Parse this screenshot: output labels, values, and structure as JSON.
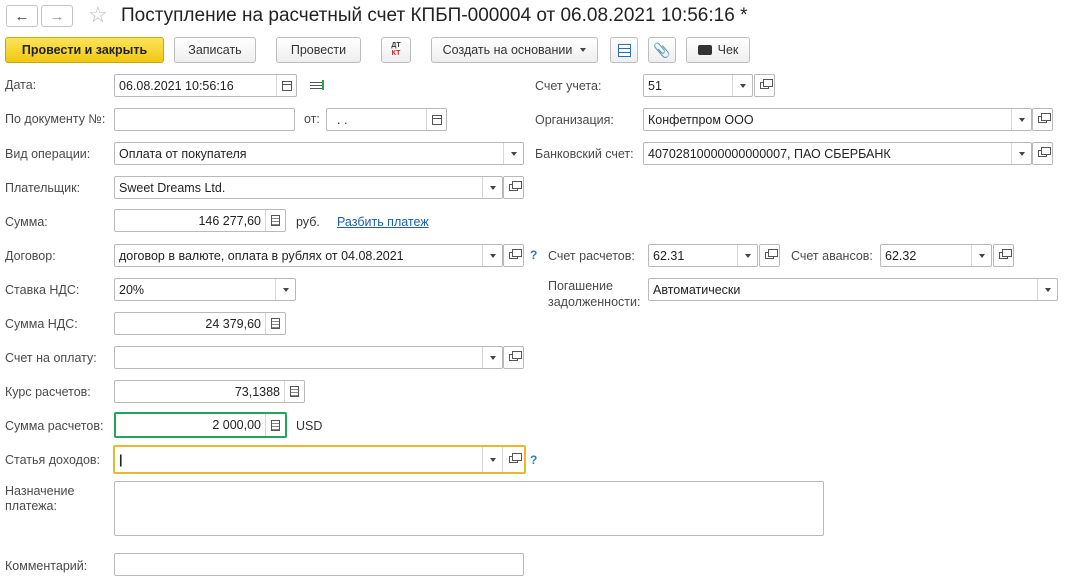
{
  "window": {
    "title": "Поступление на расчетный счет КПБП-000004 от 06.08.2021 10:56:16 *"
  },
  "toolbar": {
    "post_close": "Провести и закрыть",
    "save": "Записать",
    "post": "Провести",
    "dtkt_top": "ДТ",
    "dtkt_bottom": "КТ",
    "create_based": "Создать на основании",
    "check": "Чек"
  },
  "form": {
    "date": {
      "label": "Дата:",
      "value": "06.08.2021 10:56:16"
    },
    "doc_no": {
      "label": "По документу №:",
      "value": "",
      "from_label": "от:",
      "from_value": " .  ."
    },
    "operation": {
      "label": "Вид операции:",
      "value": "Оплата от покупателя"
    },
    "payer": {
      "label": "Плательщик:",
      "value": "Sweet Dreams Ltd."
    },
    "amount": {
      "label": "Сумма:",
      "value": "146 277,60",
      "currency": "руб.",
      "split_link": "Разбить платеж"
    },
    "contract": {
      "label": "Договор:",
      "value": "договор в валюте, оплата в рублях от 04.08.2021"
    },
    "vat_rate": {
      "label": "Ставка НДС:",
      "value": "20%"
    },
    "vat_sum": {
      "label": "Сумма НДС:",
      "value": "24 379,60"
    },
    "invoice": {
      "label": "Счет на оплату:",
      "value": ""
    },
    "rate": {
      "label": "Курс расчетов:",
      "value": "73,1388"
    },
    "settle_sum": {
      "label": "Сумма расчетов:",
      "value": "2 000,00",
      "currency": "USD"
    },
    "income_item": {
      "label": "Статья доходов:",
      "value": "|"
    },
    "purpose": {
      "label_1": "Назначение",
      "label_2": "платежа:",
      "value": ""
    },
    "comment": {
      "label": "Комментарий:",
      "value": ""
    },
    "account": {
      "label": "Счет учета:",
      "value": "51"
    },
    "organization": {
      "label": "Организация:",
      "value": "Конфетпром ООО"
    },
    "bank_account": {
      "label": "Банковский счет:",
      "value": "40702810000000000007, ПАО СБЕРБАНК"
    },
    "settle_account": {
      "label": "Счет расчетов:",
      "value": "62.31"
    },
    "advance_account": {
      "label": "Счет авансов:",
      "value": "62.32"
    },
    "debt_repay": {
      "label_1": "Погашение",
      "label_2": "задолженности:",
      "value": "Автоматически"
    },
    "help_mark": "?"
  },
  "colors": {
    "accent_yellow": "#f2c712",
    "focus_green": "#1fa65a",
    "focus_yellow": "#e8b92a",
    "link": "#1c5fb0"
  }
}
